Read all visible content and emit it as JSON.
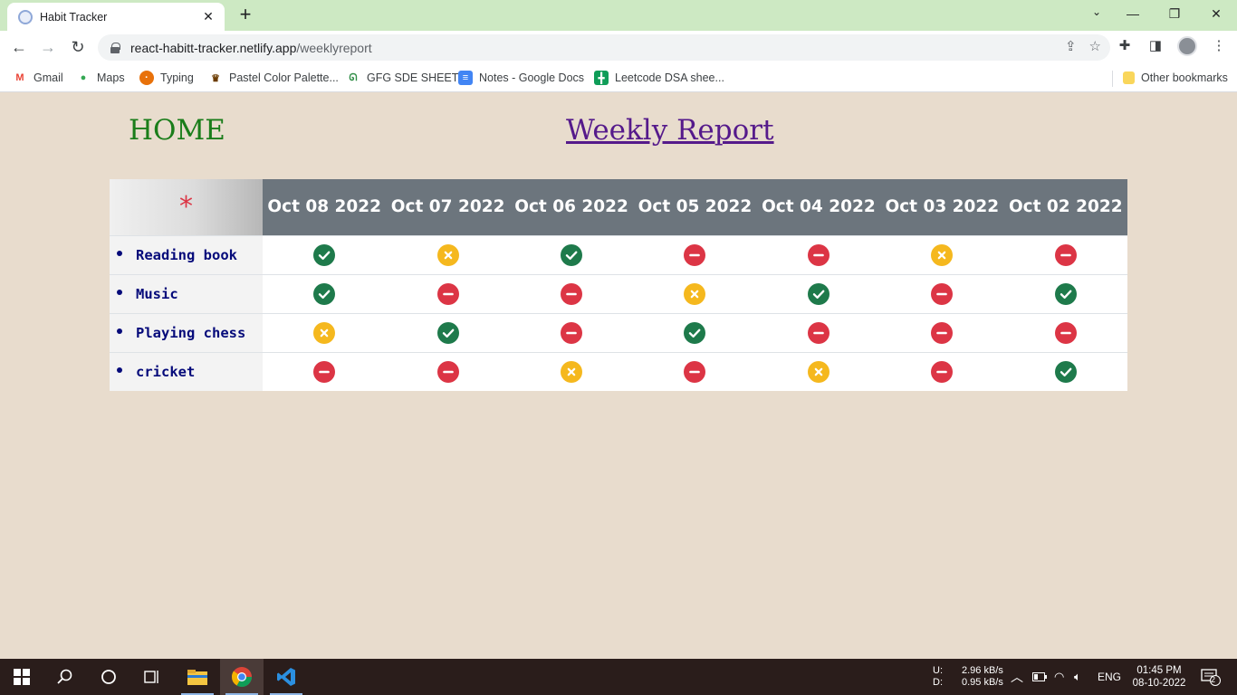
{
  "browser": {
    "tab_title": "Habit Tracker",
    "url_host": "react-habitt-tracker.netlify.app",
    "url_path": "/weeklyreport",
    "bookmarks": [
      {
        "label": "Gmail",
        "icon": "gmail-icon"
      },
      {
        "label": "Maps",
        "icon": "maps-icon"
      },
      {
        "label": "Typing",
        "icon": "typing-icon"
      },
      {
        "label": "Pastel Color Palette...",
        "icon": "palette-icon"
      },
      {
        "label": "GFG SDE SHEET",
        "icon": "gfg-icon"
      },
      {
        "label": "Notes - Google Docs",
        "icon": "docs-icon"
      },
      {
        "label": "Leetcode DSA shee...",
        "icon": "sheets-icon"
      }
    ],
    "other_bookmarks": "Other bookmarks"
  },
  "page": {
    "home_link": "HOME",
    "report_link": "Weekly Report",
    "corner_symbol": "*",
    "dates": [
      "Oct 08 2022",
      "Oct 07 2022",
      "Oct 06 2022",
      "Oct 05 2022",
      "Oct 04 2022",
      "Oct 03 2022",
      "Oct 02 2022"
    ],
    "habits": [
      {
        "name": "Reading book",
        "statuses": [
          "done",
          "none",
          "done",
          "notdone",
          "notdone",
          "none",
          "notdone"
        ]
      },
      {
        "name": "Music",
        "statuses": [
          "done",
          "notdone",
          "notdone",
          "none",
          "done",
          "notdone",
          "done"
        ]
      },
      {
        "name": "Playing chess",
        "statuses": [
          "none",
          "done",
          "notdone",
          "done",
          "notdone",
          "notdone",
          "notdone"
        ]
      },
      {
        "name": "cricket",
        "statuses": [
          "notdone",
          "notdone",
          "none",
          "notdone",
          "none",
          "notdone",
          "done"
        ]
      }
    ],
    "status_colors": {
      "done": "#1e7a4b",
      "notdone": "#dc3545",
      "none": "#f5b81e"
    }
  },
  "taskbar": {
    "net_up_label": "U:",
    "net_up": "2.96 kB/s",
    "net_down_label": "D:",
    "net_down": "0.95 kB/s",
    "language": "ENG",
    "time": "01:45 PM",
    "date": "08-10-2022",
    "notification_count": "2"
  }
}
